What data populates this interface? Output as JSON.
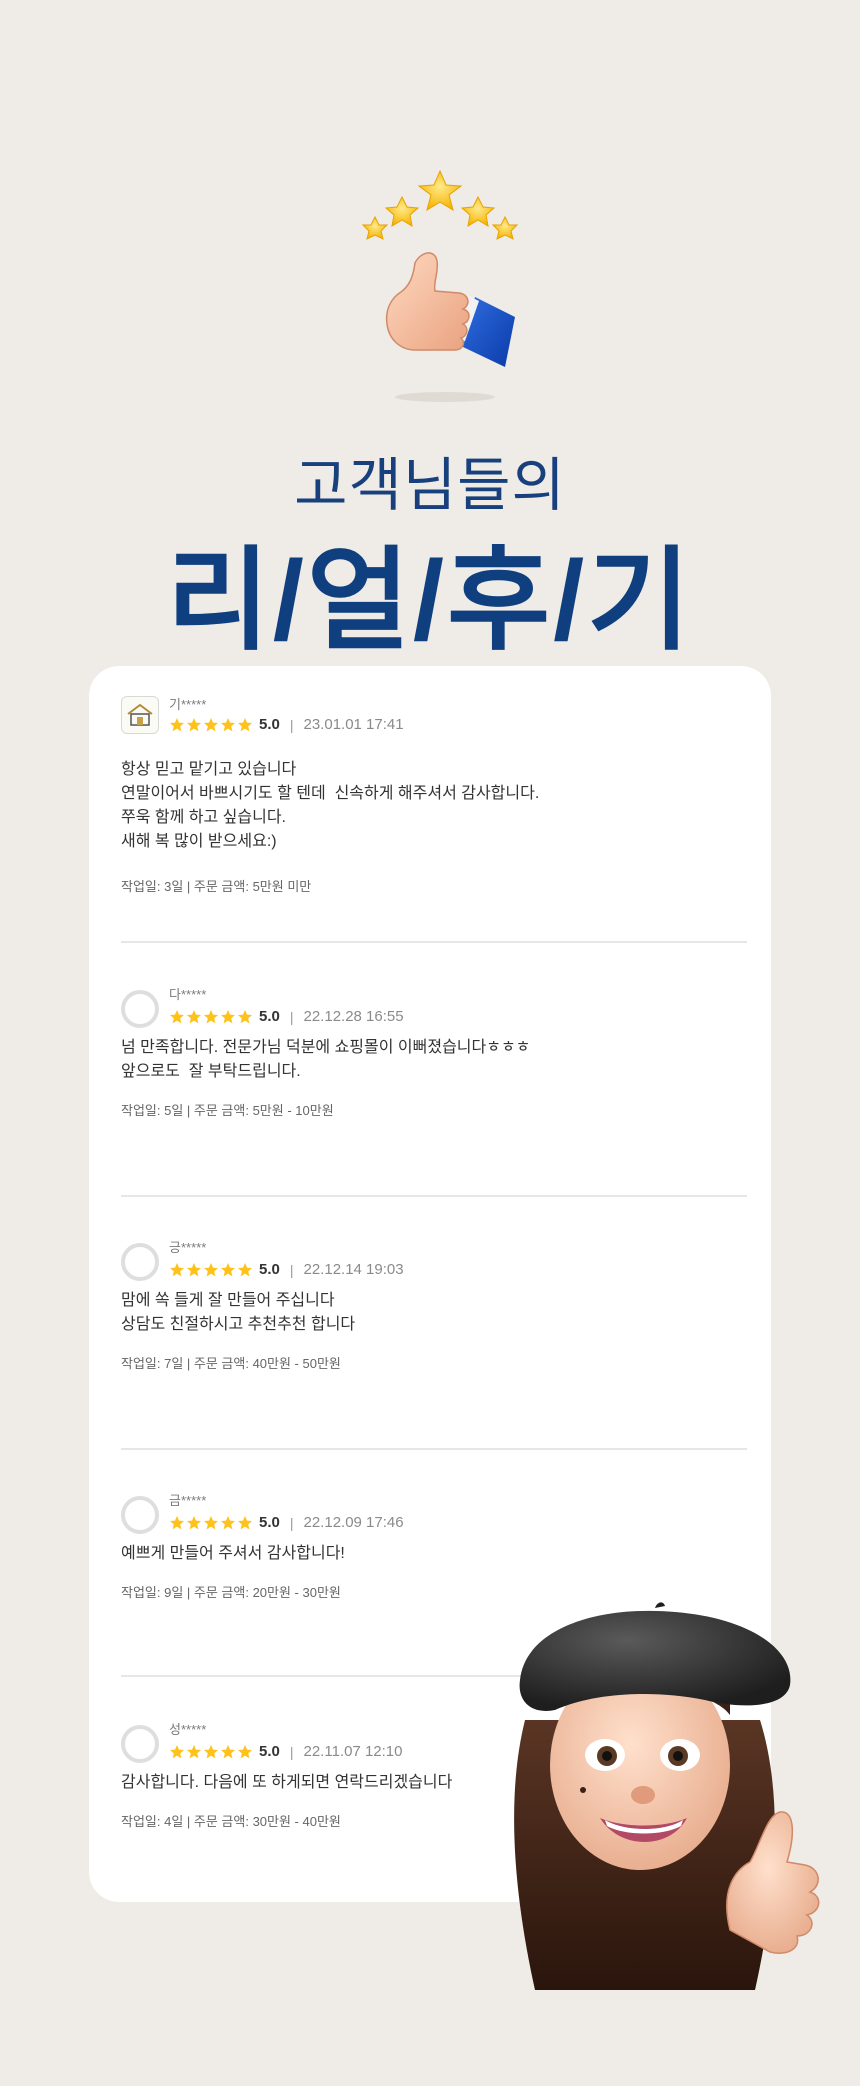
{
  "header": {
    "subtitle": "고객님들의",
    "title": "리/얼/후/기"
  },
  "colors": {
    "accent": "#0f3f7e",
    "star": "#ffc21a",
    "background": "#efebe6"
  },
  "reviews": [
    {
      "name": "기*****",
      "avatar": "logo",
      "rating": "5.0",
      "date": "23.01.01 17:41",
      "lines": [
        "항상 믿고 맡기고 있습니다",
        "연말이어서 바쁘시기도 할 텐데  신속하게 해주셔서 감사합니다.",
        "쭈욱 함께 하고 싶습니다.",
        "새해 복 많이 받으세요:)"
      ],
      "info": "작업일: 3일 | 주문 금액: 5만원 미만"
    },
    {
      "name": "다*****",
      "avatar": "user-icon",
      "rating": "5.0",
      "date": "22.12.28 16:55",
      "lines": [
        "넘 만족합니다. 전문가님 덕분에 쇼핑몰이 이뻐졌습니다ㅎㅎㅎ",
        "앞으로도  잘 부탁드립니다."
      ],
      "info": "작업일: 5일 | 주문 금액: 5만원 - 10만원"
    },
    {
      "name": "긍*****",
      "avatar": "user-icon",
      "rating": "5.0",
      "date": "22.12.14 19:03",
      "lines": [
        "맘에 쏙 들게 잘 만들어 주십니다",
        "상담도 친절하시고 추천추천 합니다"
      ],
      "info": "작업일: 7일 | 주문 금액: 40만원 - 50만원"
    },
    {
      "name": "금*****",
      "avatar": "user-icon",
      "rating": "5.0",
      "date": "22.12.09 17:46",
      "lines": [
        "예쁘게 만들어 주셔서 감사합니다!"
      ],
      "info": "작업일: 9일 | 주문 금액: 20만원 - 30만원"
    },
    {
      "name": "성*****",
      "avatar": "user-icon",
      "rating": "5.0",
      "date": "22.11.07 12:10",
      "lines": [
        "감사합니다. 다음에 또 하게되면 연락드리겠습니다"
      ],
      "info": "작업일: 4일 | 주문 금액: 30만원 - 40만원"
    }
  ]
}
